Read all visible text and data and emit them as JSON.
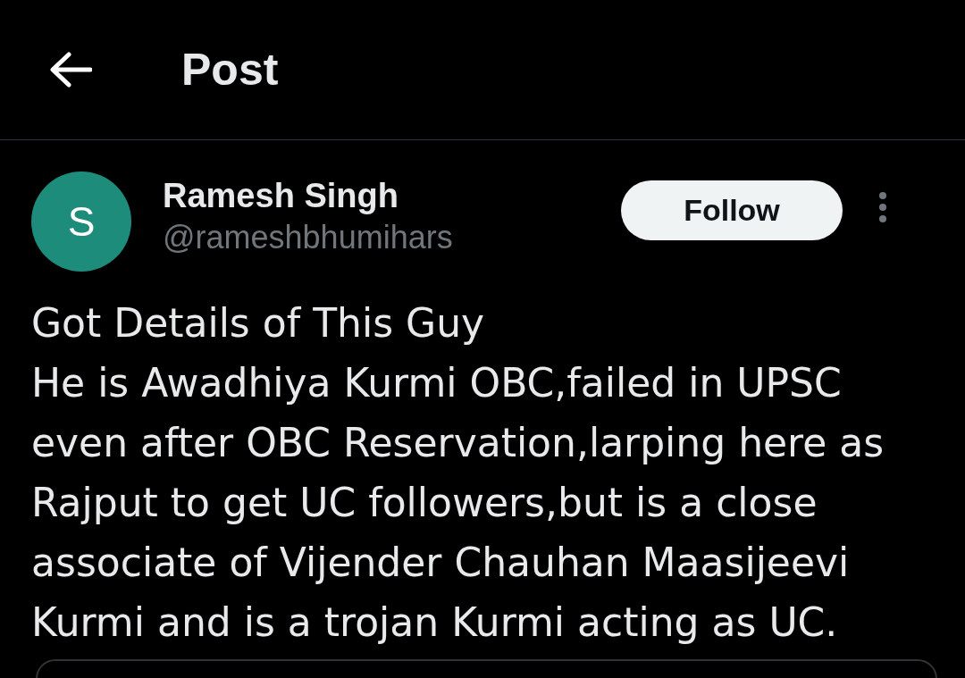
{
  "header": {
    "title": "Post"
  },
  "post": {
    "author": {
      "name": "Ramesh Singh",
      "handle": "@rameshbhumihars",
      "avatar_letter": "S",
      "color": "#1e8c7a"
    },
    "follow_button": "Follow",
    "text": "Got Details of This Guy\nHe is Awadhiya Kurmi OBC,failed in UPSC even after OBC Reservation,larping here as Rajput to get UC followers,but is a close associate of Vijender Chauhan Maasijeevi Kurmi and is a trojan Kurmi acting as UC."
  }
}
